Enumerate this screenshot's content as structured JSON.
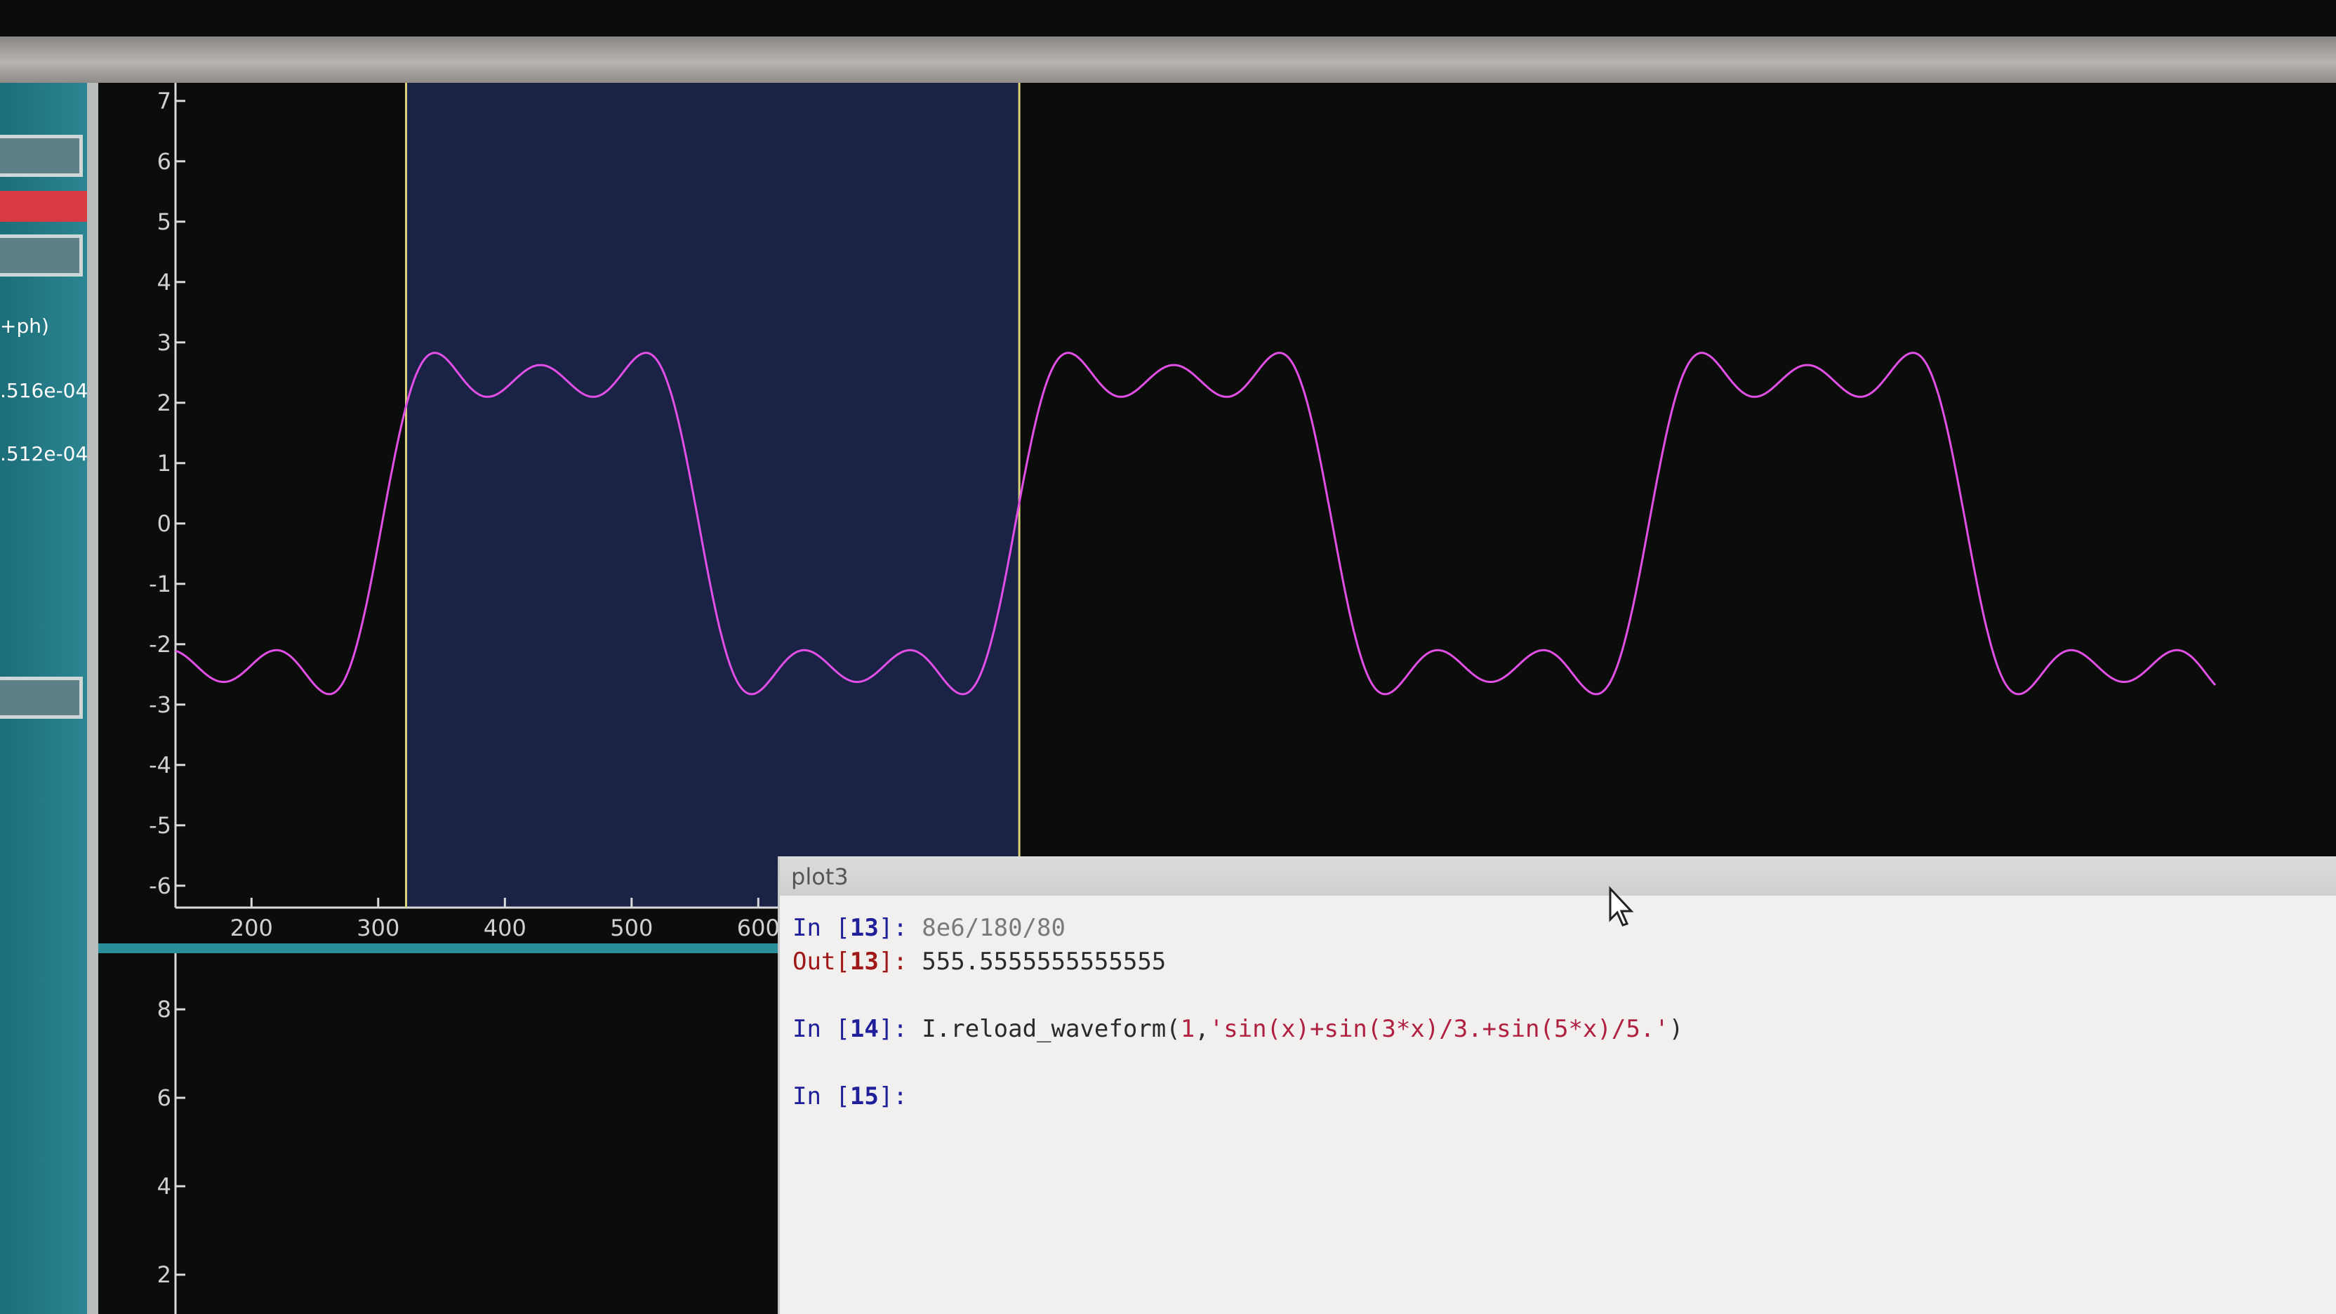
{
  "sidebar": {
    "label_1": "+ph)",
    "label_2": ".516e-04",
    "label_3": ".512e-04"
  },
  "plot_top": {
    "y_ticks": [
      "7",
      "6",
      "5",
      "4",
      "3",
      "2",
      "1",
      "0",
      "-1",
      "-2",
      "-3",
      "-4",
      "-5",
      "-6"
    ],
    "x_ticks": [
      "200",
      "300",
      "400",
      "500",
      "600"
    ],
    "trace_color": "#e24fe6",
    "cursor_color": "#d9d27a",
    "selection_color": "#1a2246"
  },
  "plot_bottom": {
    "y_ticks": [
      "8",
      "6",
      "4",
      "2"
    ]
  },
  "console": {
    "title": "plot3",
    "lines": [
      {
        "prompt_word": "In ",
        "open": "[",
        "num": "13",
        "close": "]: ",
        "code": "8e6/180/80"
      },
      {
        "prompt_word": "Out",
        "open": "[",
        "num": "13",
        "close": "]: ",
        "code": "555.5555555555555"
      },
      {
        "prompt_word": "In ",
        "open": "[",
        "num": "14",
        "close": "]: ",
        "code_a": "I.reload_waveform(",
        "code_b": "1",
        "code_c": ",",
        "code_d": "'sin(x)+sin(3*x)/3.+sin(5*x)/5.'",
        "code_e": ")"
      },
      {
        "prompt_word": "In ",
        "open": "[",
        "num": "15",
        "close": "]: "
      }
    ]
  },
  "chart_data": {
    "type": "line",
    "title": "",
    "xlabel": "",
    "ylabel": "",
    "xlim": [
      140,
      1750
    ],
    "ylim": [
      -6.1,
      7.3
    ],
    "series": [
      {
        "label": "sin(x)+sin(3*x)/3.+sin(5*x)/5.",
        "amplitude": 3.05,
        "period": 500,
        "zero_crossing_x": 303
      }
    ],
    "cursors_x": [
      322,
      806
    ]
  }
}
